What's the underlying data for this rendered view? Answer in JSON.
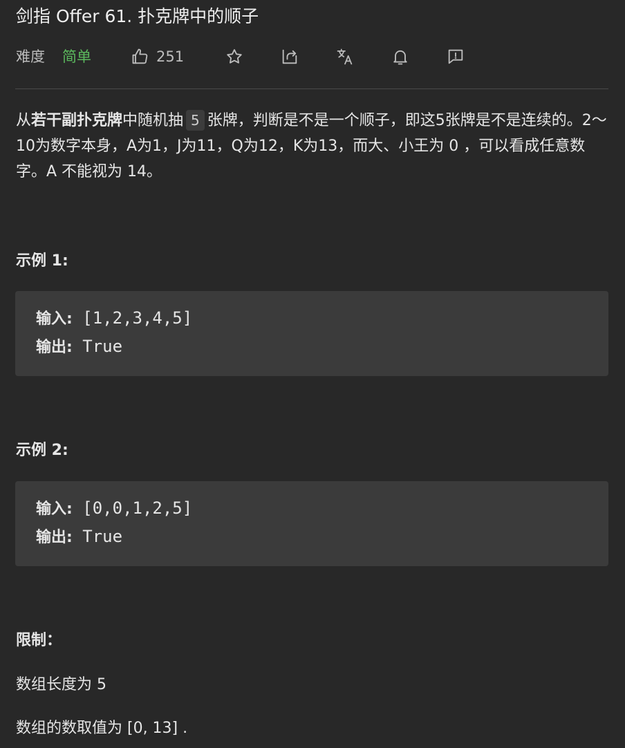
{
  "problem": {
    "title": "剑指 Offer 61. 扑克牌中的顺子",
    "difficulty_label": "难度",
    "difficulty": "简单",
    "likes": "251"
  },
  "description": {
    "p1_pre": "从",
    "p1_bold": "若干副扑克牌",
    "p1_mid": "中随机抽",
    "p1_code": "5",
    "p1_rest": "张牌，判断是不是一个顺子，即这5张牌是不是连续的。2～10为数字本身，A为1，J为11，Q为12，K为13，而大、小王为 0 ，可以看成任意数字。A 不能视为 14。"
  },
  "examples": [
    {
      "title": "示例 1:",
      "input_label": "输入:",
      "input": "[1,2,3,4,5]",
      "output_label": "输出:",
      "output": "True"
    },
    {
      "title": "示例 2:",
      "input_label": "输入:",
      "input": "[0,0,1,2,5]",
      "output_label": "输出:",
      "output": "True"
    }
  ],
  "limits": {
    "title": "限制：",
    "line1": "数组长度为 5",
    "line2": "数组的数取值为 [0, 13] ."
  },
  "icons": [
    "thumbs-up-icon",
    "star-icon",
    "share-icon",
    "translate-icon",
    "bell-icon",
    "feedback-icon"
  ],
  "colors": {
    "background": "#282828",
    "easy": "#5bb85d",
    "code_bg": "#3b3b3b"
  }
}
